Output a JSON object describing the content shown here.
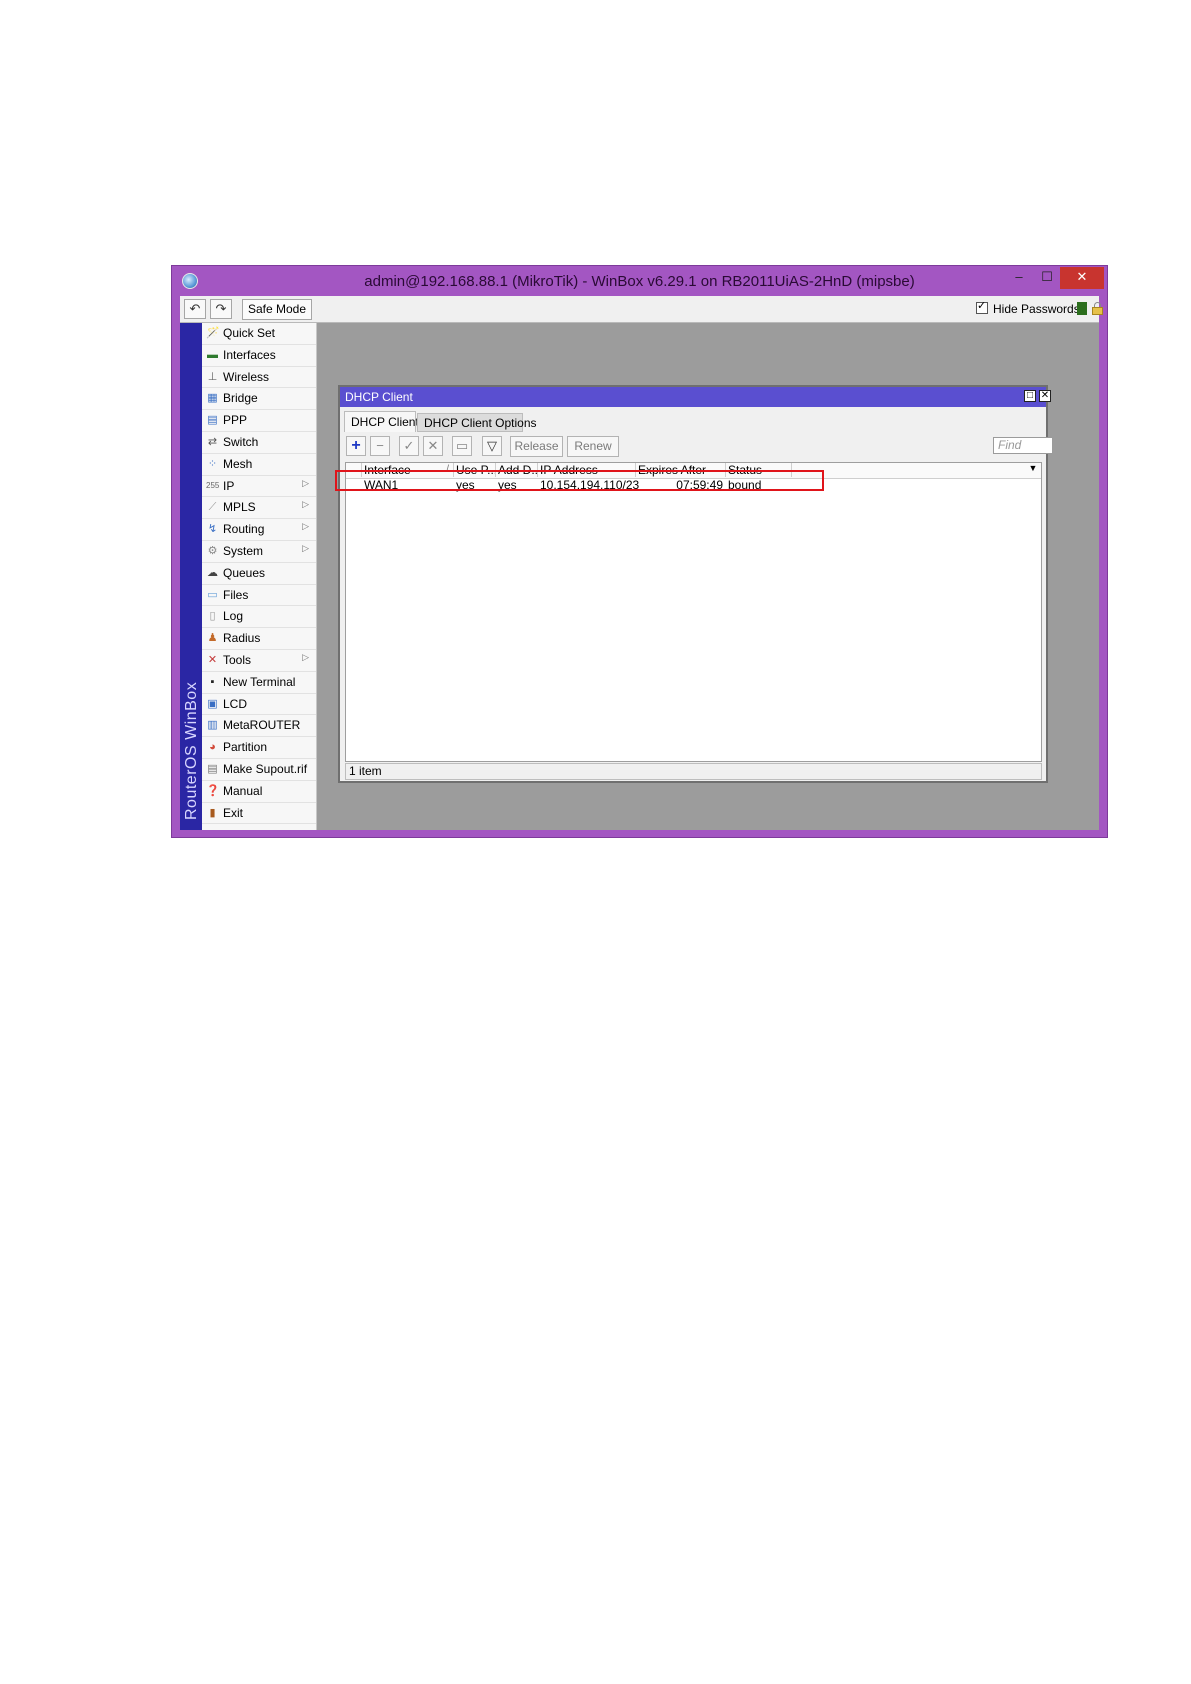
{
  "window": {
    "title": "admin@192.168.88.1 (MikroTik) - WinBox v6.29.1 on RB2011UiAS-2HnD (mipsbe)",
    "min_icon": "minimize-icon",
    "max_icon": "maximize-icon",
    "close_icon": "close-icon"
  },
  "toolbar": {
    "undo_icon": "undo-icon",
    "redo_icon": "redo-icon",
    "safe_mode_label": "Safe Mode",
    "hide_passwords_label": "Hide Passwords",
    "hide_passwords_checked": true
  },
  "sidebar": {
    "brand": "RouterOS WinBox",
    "items": [
      {
        "label": "Quick Set",
        "icon": "wand-icon",
        "arrow": false
      },
      {
        "label": "Interfaces",
        "icon": "network-card-icon",
        "arrow": false
      },
      {
        "label": "Wireless",
        "icon": "antenna-icon",
        "arrow": false
      },
      {
        "label": "Bridge",
        "icon": "bridge-icon",
        "arrow": false
      },
      {
        "label": "PPP",
        "icon": "ppp-icon",
        "arrow": false
      },
      {
        "label": "Switch",
        "icon": "switch-icon",
        "arrow": false
      },
      {
        "label": "Mesh",
        "icon": "mesh-icon",
        "arrow": false
      },
      {
        "label": "IP",
        "icon": "ip-icon",
        "arrow": true
      },
      {
        "label": "MPLS",
        "icon": "mpls-icon",
        "arrow": true
      },
      {
        "label": "Routing",
        "icon": "routing-icon",
        "arrow": true
      },
      {
        "label": "System",
        "icon": "gear-icon",
        "arrow": true
      },
      {
        "label": "Queues",
        "icon": "queues-icon",
        "arrow": false
      },
      {
        "label": "Files",
        "icon": "folder-icon",
        "arrow": false
      },
      {
        "label": "Log",
        "icon": "log-icon",
        "arrow": false
      },
      {
        "label": "Radius",
        "icon": "users-icon",
        "arrow": false
      },
      {
        "label": "Tools",
        "icon": "tools-icon",
        "arrow": true
      },
      {
        "label": "New Terminal",
        "icon": "terminal-icon",
        "arrow": false
      },
      {
        "label": "LCD",
        "icon": "monitor-icon",
        "arrow": false
      },
      {
        "label": "MetaROUTER",
        "icon": "metarouter-icon",
        "arrow": false
      },
      {
        "label": "Partition",
        "icon": "pie-icon",
        "arrow": false
      },
      {
        "label": "Make Supout.rif",
        "icon": "document-icon",
        "arrow": false
      },
      {
        "label": "Manual",
        "icon": "help-icon",
        "arrow": false
      },
      {
        "label": "Exit",
        "icon": "exit-icon",
        "arrow": false
      }
    ]
  },
  "dialog": {
    "title": "DHCP Client",
    "tabs": [
      "DHCP Client",
      "DHCP Client Options"
    ],
    "buttons": {
      "release": "Release",
      "renew": "Renew"
    },
    "find_placeholder": "Find",
    "columns": [
      "Interface",
      "Use P...",
      "Add D...",
      "IP Address",
      "Expires After",
      "Status"
    ],
    "sort_indicator": "/",
    "rows": [
      {
        "interface": "WAN1",
        "use_peer_dns": "yes",
        "add_default_route": "yes",
        "ip_address": "10.154.194.110/23",
        "expires_after": "07:59:49",
        "status": "bound"
      }
    ],
    "status_text": "1 item"
  },
  "colors": {
    "window_frame": "#a356c2",
    "winbox_strip": "#2a26a4",
    "dialog_title": "#5a4fd0",
    "highlight": "#e0141a"
  }
}
